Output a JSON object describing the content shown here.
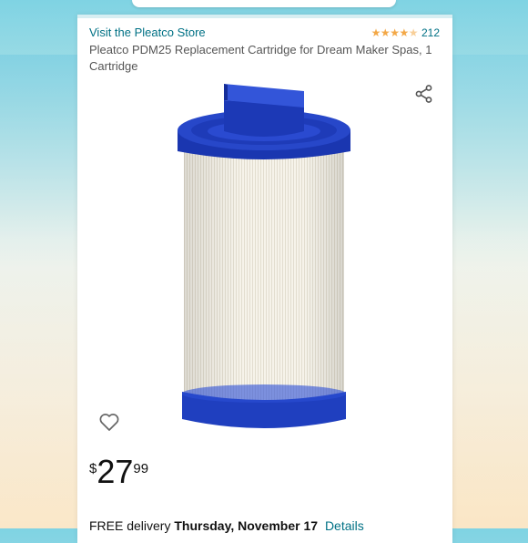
{
  "store": {
    "link_text": "Visit the Pleatco Store"
  },
  "rating": {
    "stars": "★★★★",
    "half_star": "★",
    "count": "212",
    "value": 4.5
  },
  "product": {
    "title": "Pleatco PDM25 Replacement Cartridge for Dream Maker Spas, 1 Cartridge"
  },
  "icons": {
    "share": "share-icon",
    "wishlist": "heart-icon"
  },
  "price": {
    "symbol": "$",
    "whole": "27",
    "fraction": "99"
  },
  "delivery": {
    "prefix": "FREE delivery",
    "date": "Thursday, November 17",
    "details_link": "Details"
  },
  "colors": {
    "link": "#007185",
    "star": "#f3a847",
    "cartridge_cap": "#1f3fbf",
    "filter_pleats": "#f4f1e8"
  }
}
